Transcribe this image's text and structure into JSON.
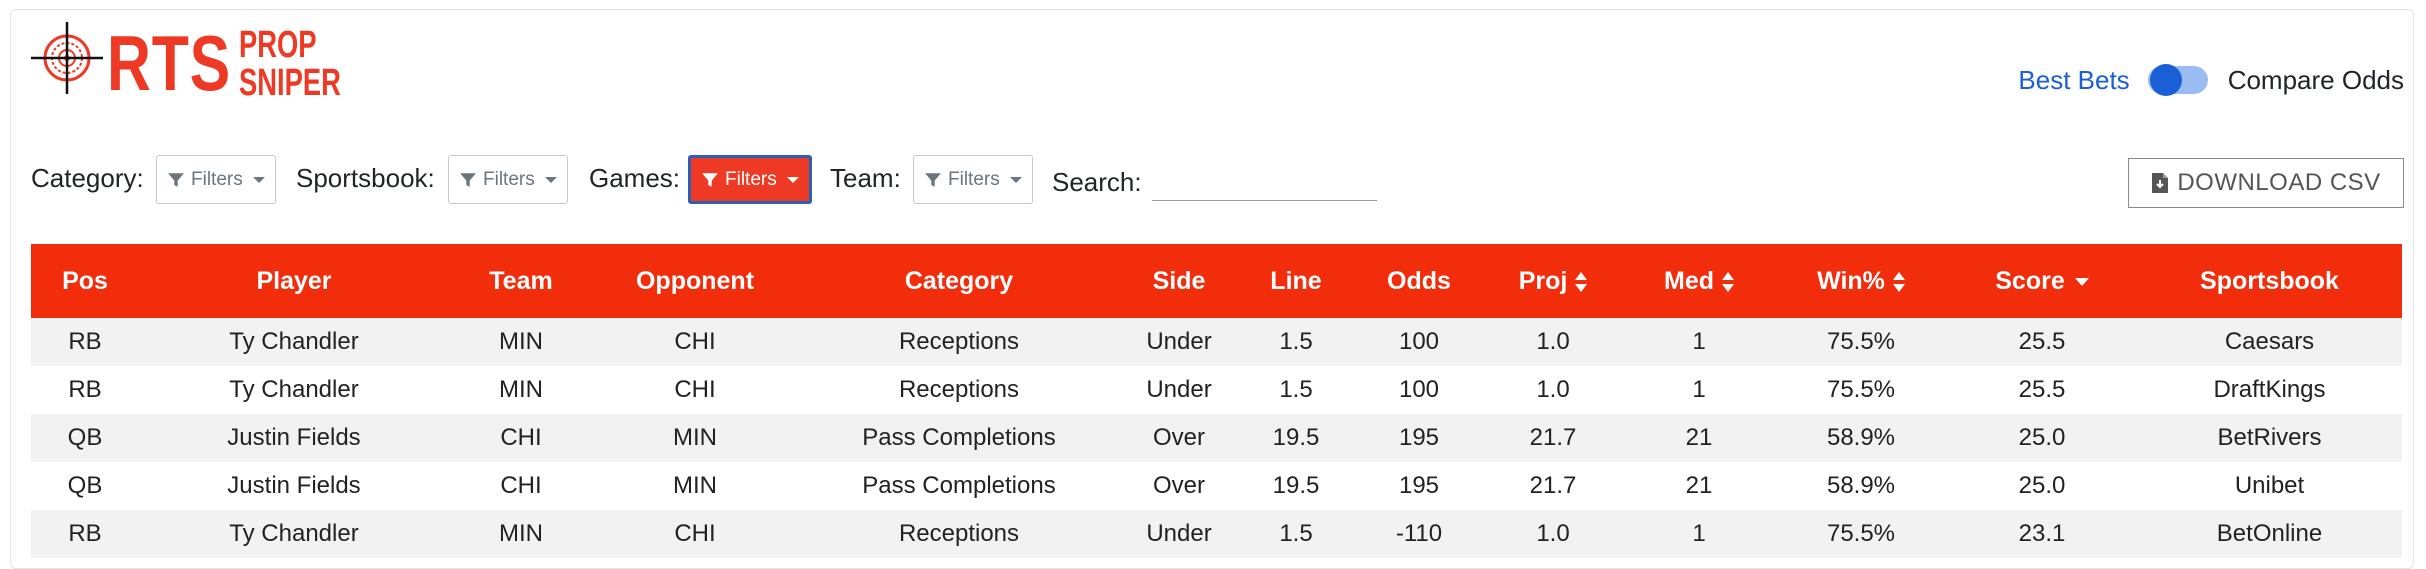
{
  "brand": {
    "rts": "RTS",
    "prop_line1": "PROP",
    "prop_line2": "SNIPER",
    "accent_color": "#ee3a24"
  },
  "toggle": {
    "left_label": "Best Bets",
    "right_label": "Compare Odds",
    "state": "best-bets"
  },
  "filters": {
    "category_label": "Category:",
    "sportsbook_label": "Sportsbook:",
    "games_label": "Games:",
    "team_label": "Team:",
    "search_label": "Search:",
    "button_label": "Filters",
    "search_value": "",
    "icon": "filter-funnel-icon"
  },
  "download": {
    "label": "DOWNLOAD CSV",
    "icon": "file-download-icon"
  },
  "table": {
    "header_color": "#f22d0c",
    "columns": [
      "Pos",
      "Player",
      "Team",
      "Opponent",
      "Category",
      "Side",
      "Line",
      "Odds",
      "Proj",
      "Med",
      "Win%",
      "Score",
      "Sportsbook"
    ],
    "rows": [
      [
        "RB",
        "Ty Chandler",
        "MIN",
        "CHI",
        "Receptions",
        "Under",
        "1.5",
        "100",
        "1.0",
        "1",
        "75.5%",
        "25.5",
        "Caesars"
      ],
      [
        "RB",
        "Ty Chandler",
        "MIN",
        "CHI",
        "Receptions",
        "Under",
        "1.5",
        "100",
        "1.0",
        "1",
        "75.5%",
        "25.5",
        "DraftKings"
      ],
      [
        "QB",
        "Justin Fields",
        "CHI",
        "MIN",
        "Pass Completions",
        "Over",
        "19.5",
        "195",
        "21.7",
        "21",
        "58.9%",
        "25.0",
        "BetRivers"
      ],
      [
        "QB",
        "Justin Fields",
        "CHI",
        "MIN",
        "Pass Completions",
        "Over",
        "19.5",
        "195",
        "21.7",
        "21",
        "58.9%",
        "25.0",
        "Unibet"
      ],
      [
        "RB",
        "Ty Chandler",
        "MIN",
        "CHI",
        "Receptions",
        "Under",
        "1.5",
        "-110",
        "1.0",
        "1",
        "75.5%",
        "23.1",
        "BetOnline"
      ]
    ]
  }
}
